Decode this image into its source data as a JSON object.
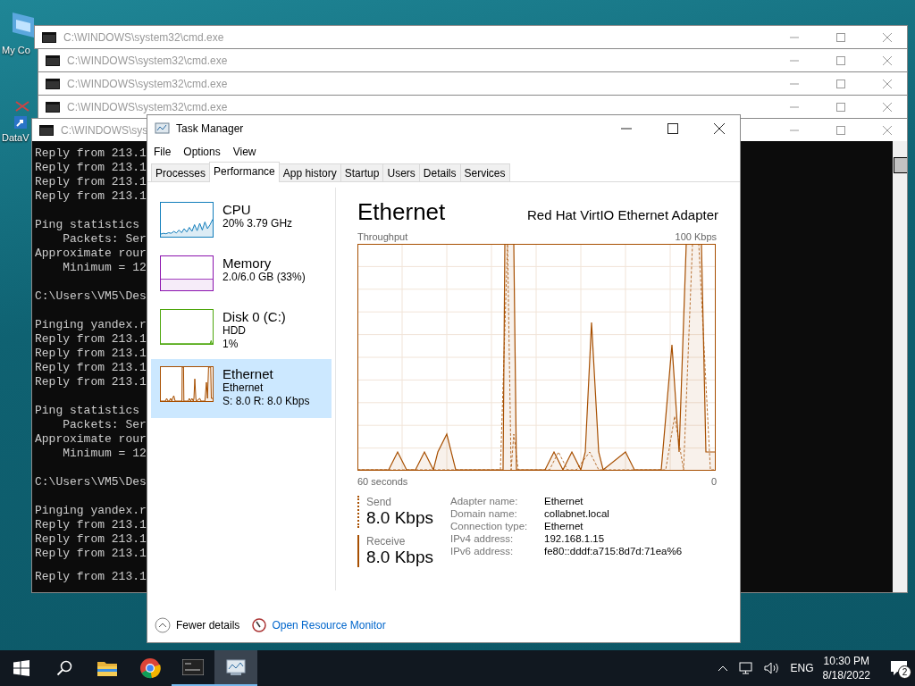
{
  "desktop": {
    "icons": [
      {
        "label": "My Co",
        "kind": "computer"
      },
      {
        "label": "DataV",
        "kind": "shortcut"
      }
    ]
  },
  "cmd_windows": [
    {
      "title": "C:\\WINDOWS\\system32\\cmd.exe"
    },
    {
      "title": "C:\\WINDOWS\\system32\\cmd.exe"
    },
    {
      "title": "C:\\WINDOWS\\system32\\cmd.exe"
    },
    {
      "title": "C:\\WINDOWS\\system32\\cmd.exe"
    },
    {
      "title": "C:\\WINDOWS\\sys"
    }
  ],
  "console": {
    "blocks": [
      [
        "Reply from 213.1",
        "Reply from 213.1",
        "Reply from 213.1",
        "Reply from 213.1"
      ],
      [
        "Ping statistics ",
        "    Packets: Ser",
        "Approximate rour",
        "    Minimum = 12"
      ],
      [
        "C:\\Users\\VM5\\Des"
      ],
      [
        "Pinging yandex.r",
        "Reply from 213.1",
        "Reply from 213.1",
        "Reply from 213.1",
        "Reply from 213.1"
      ],
      [
        "Ping statistics ",
        "    Packets: Ser",
        "Approximate rour",
        "    Minimum = 12"
      ],
      [
        "C:\\Users\\VM5\\Des"
      ],
      [
        "Pinging yandex.r",
        "Reply from 213.1",
        "Reply from 213.1",
        "Reply from 213.1"
      ],
      [
        "Reply from 213.1"
      ]
    ]
  },
  "task_manager": {
    "title": "Task Manager",
    "menu": [
      "File",
      "Options",
      "View"
    ],
    "tabs": [
      {
        "label": "Processes",
        "selected": false
      },
      {
        "label": "Performance",
        "selected": true
      },
      {
        "label": "App history",
        "selected": false
      },
      {
        "label": "Startup",
        "selected": false
      },
      {
        "label": "Users",
        "selected": false
      },
      {
        "label": "Details",
        "selected": false
      },
      {
        "label": "Services",
        "selected": false
      }
    ],
    "resources": [
      {
        "kind": "cpu",
        "name": "CPU",
        "lines": [
          "20% 3.79 GHz"
        ],
        "color": "#117dbb",
        "selected": false
      },
      {
        "kind": "memory",
        "name": "Memory",
        "lines": [
          "2.0/6.0 GB (33%)"
        ],
        "color": "#8b12ae",
        "selected": false
      },
      {
        "kind": "disk",
        "name": "Disk 0 (C:)",
        "lines": [
          "HDD",
          "1%"
        ],
        "color": "#4da60c",
        "selected": false
      },
      {
        "kind": "network",
        "name": "Ethernet",
        "lines": [
          "Ethernet",
          "S: 8.0 R: 8.0 Kbps"
        ],
        "color": "#a74f01",
        "selected": true
      }
    ],
    "detail": {
      "title": "Ethernet",
      "adapter": "Red Hat VirtIO Ethernet Adapter",
      "chart_label": "Throughput",
      "chart_max": "100 Kbps",
      "time_span": "60 seconds",
      "time_end": "0",
      "send": {
        "label": "Send",
        "value": "8.0 Kbps"
      },
      "receive": {
        "label": "Receive",
        "value": "8.0 Kbps"
      },
      "properties": [
        {
          "label": "Adapter name:",
          "value": "Ethernet"
        },
        {
          "label": "Domain name:",
          "value": "collabnet.local"
        },
        {
          "label": "Connection type:",
          "value": "Ethernet"
        },
        {
          "label": "IPv4 address:",
          "value": "192.168.1.15"
        },
        {
          "label": "IPv6 address:",
          "value": "fe80::dddf:a715:8d7d:71ea%6"
        }
      ]
    },
    "footer": {
      "fewer_details": "Fewer details",
      "resource_monitor": "Open Resource Monitor"
    }
  },
  "taskbar": {
    "apps": [
      {
        "kind": "start",
        "running": false,
        "focused": false
      },
      {
        "kind": "search",
        "running": false,
        "focused": false
      },
      {
        "kind": "explorer",
        "running": false,
        "focused": false
      },
      {
        "kind": "browser",
        "running": false,
        "focused": false
      },
      {
        "kind": "console",
        "running": true,
        "focused": false
      },
      {
        "kind": "taskmgr",
        "running": true,
        "focused": true
      }
    ],
    "language": "ENG",
    "time": "10:30 PM",
    "date": "8/18/2022",
    "notifications": "2"
  }
}
